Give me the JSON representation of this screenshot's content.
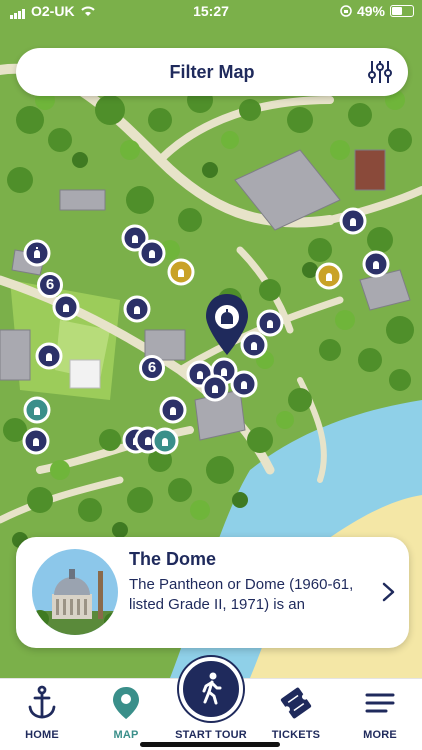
{
  "status_bar": {
    "carrier": "O2-UK",
    "time": "15:27",
    "battery": "49%"
  },
  "filter": {
    "title": "Filter Map"
  },
  "card": {
    "title": "The Dome",
    "description": "The Pantheon or Dome (1960-61, listed Grade II, 1971) is an"
  },
  "nav": {
    "items": [
      {
        "label": "HOME",
        "icon": "anchor-icon"
      },
      {
        "label": "MAP",
        "icon": "map-pin-icon",
        "active": true
      },
      {
        "label": "START TOUR",
        "icon": "walking-person-icon"
      },
      {
        "label": "TICKETS",
        "icon": "ticket-icon"
      },
      {
        "label": "MORE",
        "icon": "menu-icon"
      }
    ]
  },
  "map": {
    "markers": {
      "numbered_label": "6"
    }
  },
  "colors": {
    "navy": "#1f2a5c",
    "teal": "#3a8f8a",
    "gold": "#c9a227",
    "grass": "#7bb04a",
    "sea": "#8fd0e8",
    "sand": "#f4e7a6"
  }
}
